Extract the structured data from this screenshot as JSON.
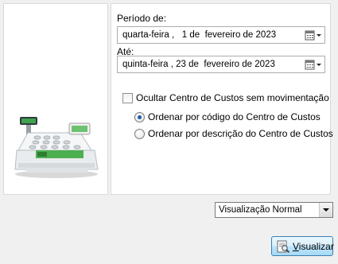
{
  "periodo": {
    "label": "Período de:",
    "weekday": "quarta-feira",
    "day": "1",
    "month": "fevereiro",
    "year": "2023"
  },
  "ate": {
    "label": "Até:",
    "weekday": "quinta-feira",
    "day": "23",
    "month": "fevereiro",
    "year": "2023"
  },
  "options": {
    "ocultar_label": "Ocultar Centro de Custos sem movimentação",
    "ocultar_checked": false,
    "ordem_codigo_label": "Ordenar por código do Centro de Custos",
    "ordem_descricao_label": "Ordenar por descrição do Centro de Custos",
    "ordem_selected": "codigo"
  },
  "visualizacao": {
    "selected": "Visualização Normal"
  },
  "button": {
    "visualizar": "Visualizar",
    "underline_char": "V"
  },
  "icons": {
    "image": "cash-register-icon",
    "calendar": "calendar-dropdown-icon",
    "button": "report-preview-icon"
  },
  "colors": {
    "radio_selected": "#1e5aa8",
    "button_border": "#3c7fb1"
  }
}
